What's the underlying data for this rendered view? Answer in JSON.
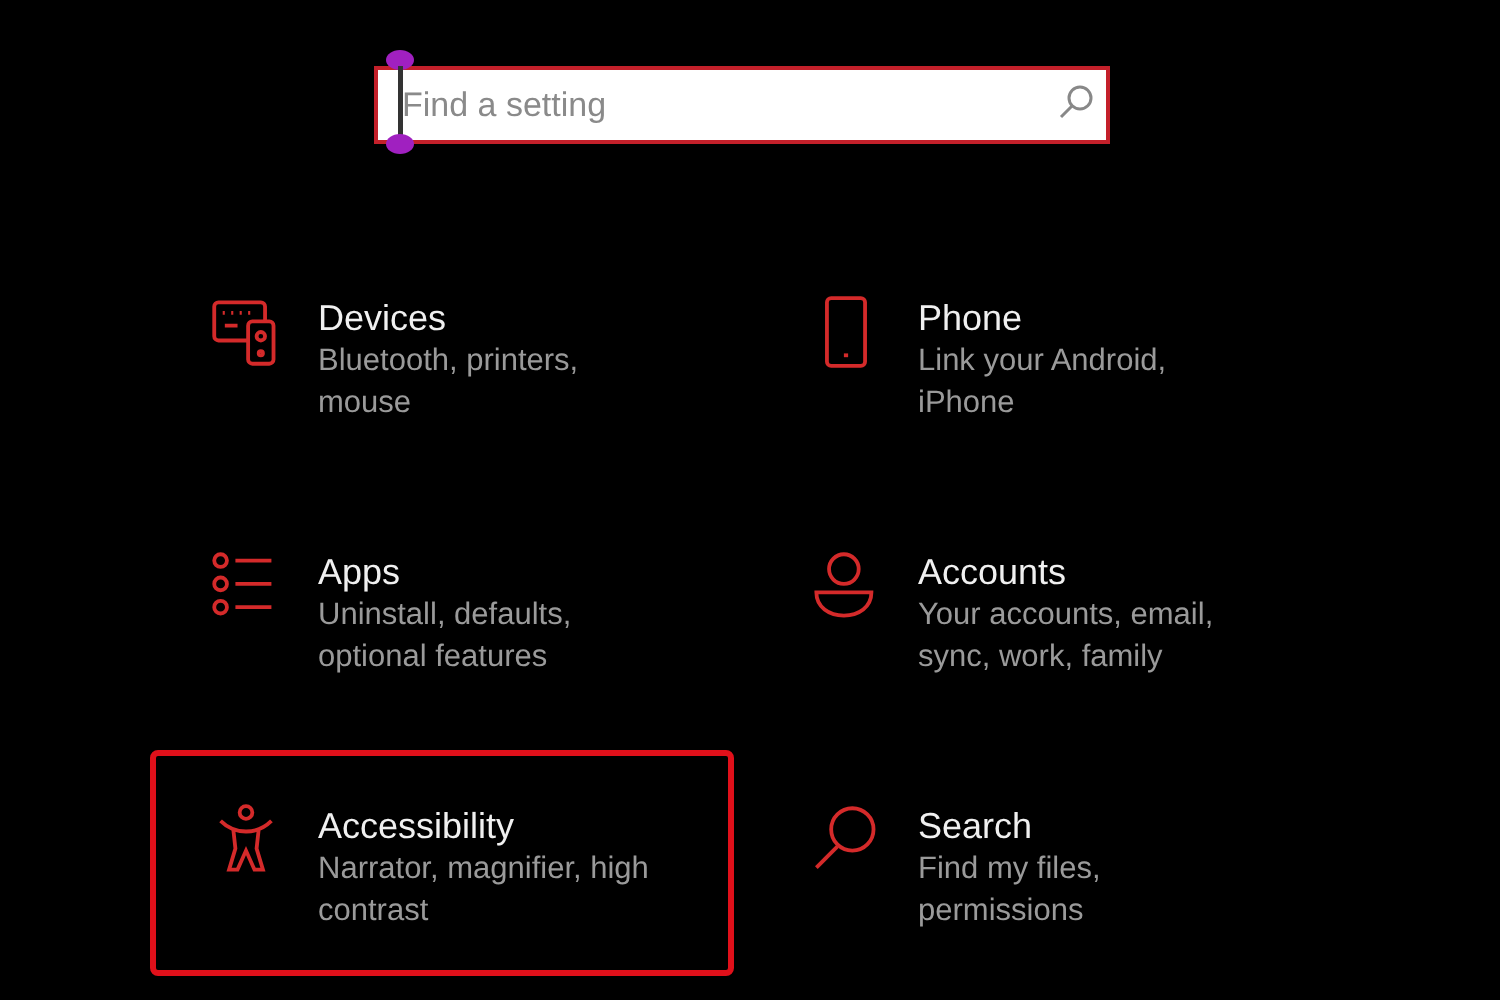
{
  "search": {
    "placeholder": "Find a setting"
  },
  "categories": [
    {
      "title": "Devices",
      "subtitle": "Bluetooth, printers, mouse",
      "selected": false
    },
    {
      "title": "Phone",
      "subtitle": "Link your Android, iPhone",
      "selected": false
    },
    {
      "title": "Apps",
      "subtitle": "Uninstall, defaults, optional features",
      "selected": false
    },
    {
      "title": "Accounts",
      "subtitle": "Your accounts, email, sync, work, family",
      "selected": false
    },
    {
      "title": "Accessibility",
      "subtitle": "Narrator, magnifier, high contrast",
      "selected": true
    },
    {
      "title": "Search",
      "subtitle": "Find my files, permissions",
      "selected": false
    }
  ]
}
